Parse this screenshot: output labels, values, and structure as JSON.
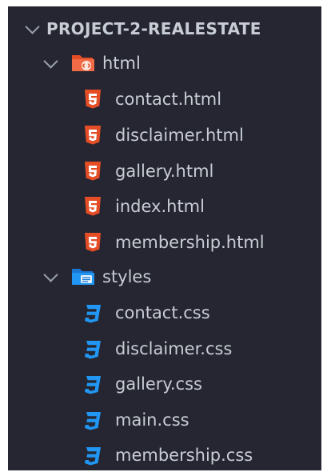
{
  "explorer": {
    "project": {
      "label": "PROJECT-2-REALESTATE",
      "expanded": true
    },
    "folders": [
      {
        "label": "html",
        "icon": "html-folder-icon",
        "expanded": true,
        "color": "#e44d26",
        "files": [
          {
            "label": "contact.html",
            "icon": "html5-icon"
          },
          {
            "label": "disclaimer.html",
            "icon": "html5-icon"
          },
          {
            "label": "gallery.html",
            "icon": "html5-icon"
          },
          {
            "label": "index.html",
            "icon": "html5-icon"
          },
          {
            "label": "membership.html",
            "icon": "html5-icon"
          }
        ]
      },
      {
        "label": "styles",
        "icon": "css-folder-icon",
        "expanded": true,
        "color": "#2196f3",
        "files": [
          {
            "label": "contact.css",
            "icon": "css3-icon"
          },
          {
            "label": "disclaimer.css",
            "icon": "css3-icon"
          },
          {
            "label": "gallery.css",
            "icon": "css3-icon"
          },
          {
            "label": "main.css",
            "icon": "css3-icon"
          },
          {
            "label": "membership.css",
            "icon": "css3-icon"
          }
        ]
      }
    ]
  },
  "colors": {
    "background": "#252631",
    "text": "#c8ccd4",
    "html_accent": "#e44d26",
    "css_accent": "#2196f3"
  }
}
